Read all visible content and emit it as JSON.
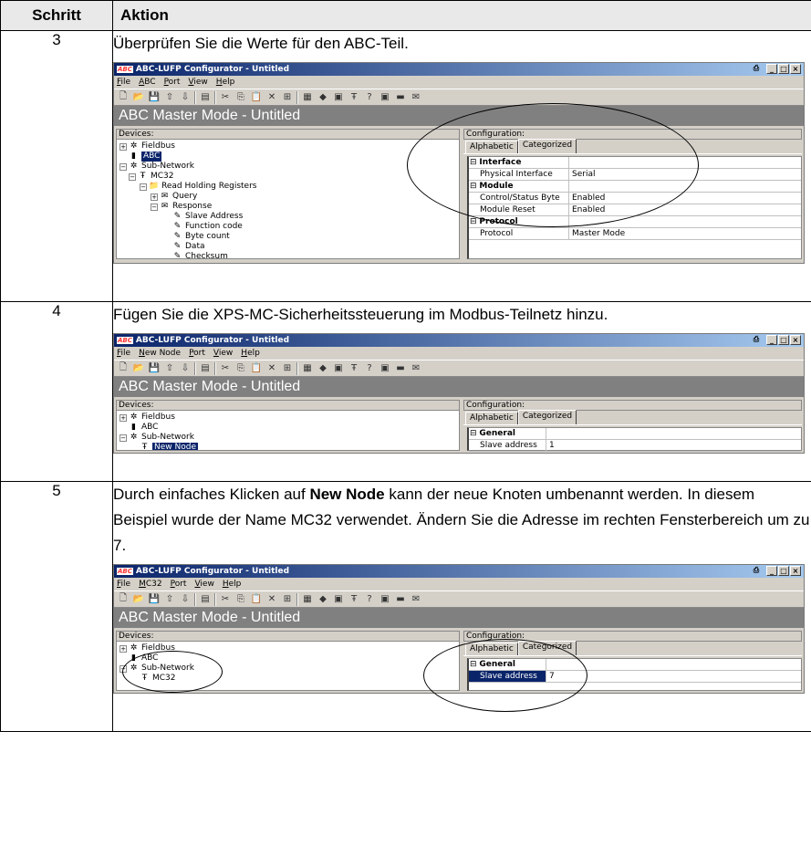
{
  "header": {
    "col_step": "Schritt",
    "col_action": "Aktion"
  },
  "rows": [
    {
      "step": "3",
      "text": "Überprüfen Sie die Werte für den ABC-Teil.",
      "window": {
        "title": "ABC-LUFP Configurator - Untitled",
        "app_logo": "ABC",
        "menu": [
          "File",
          "ABC",
          "Port",
          "View",
          "Help"
        ],
        "mode_title": "ABC Master Mode - Untitled",
        "devices_label": "Devices:",
        "config_label": "Configuration:",
        "tab_alphabetic": "Alphabetic",
        "tab_categorized": "Categorized",
        "tree": [
          "Fieldbus",
          "ABC",
          "Sub-Network",
          "MC32",
          "Read Holding Registers",
          "Query",
          "Response",
          "Slave Address",
          "Function code",
          "Byte count",
          "Data",
          "Checksum"
        ],
        "grid": [
          {
            "k": "Interface",
            "v": "",
            "cat": true
          },
          {
            "k": "Physical Interface",
            "v": "Serial"
          },
          {
            "k": "Module",
            "v": "",
            "cat": true
          },
          {
            "k": "Control/Status Byte",
            "v": "Enabled"
          },
          {
            "k": "Module Reset",
            "v": "Enabled"
          },
          {
            "k": "Protocol",
            "v": "",
            "cat": true
          },
          {
            "k": "Protocol",
            "v": "Master Mode"
          }
        ]
      }
    },
    {
      "step": "4",
      "text": "Fügen Sie die XPS-MC-Sicherheitssteuerung im Modbus-Teilnetz hinzu.",
      "window": {
        "title": "ABC-LUFP Configurator - Untitled",
        "app_logo": "ABC",
        "menu": [
          "File",
          "New Node",
          "Port",
          "View",
          "Help"
        ],
        "mode_title": "ABC Master Mode - Untitled",
        "devices_label": "Devices:",
        "config_label": "Configuration:",
        "tab_alphabetic": "Alphabetic",
        "tab_categorized": "Categorized",
        "tree": [
          "Fieldbus",
          "ABC",
          "Sub-Network",
          "New Node"
        ],
        "grid": [
          {
            "k": "General",
            "v": "",
            "cat": true
          },
          {
            "k": "Slave address",
            "v": "1"
          }
        ]
      }
    },
    {
      "step": "5",
      "text_pre": "Durch einfaches Klicken auf ",
      "text_bold": "New Node",
      "text_post": " kann der neue Knoten umbenannt werden. In diesem Beispiel wurde der Name MC32 verwendet. Ändern Sie die Adresse im rechten Fensterbereich um zu 7.",
      "window": {
        "title": "ABC-LUFP Configurator - Untitled",
        "app_logo": "ABC",
        "menu": [
          "File",
          "MC32",
          "Port",
          "View",
          "Help"
        ],
        "mode_title": "ABC Master Mode - Untitled",
        "devices_label": "Devices:",
        "config_label": "Configuration:",
        "tab_alphabetic": "Alphabetic",
        "tab_categorized": "Categorized",
        "tree": [
          "Fieldbus",
          "ABC",
          "Sub-Network",
          "MC32"
        ],
        "grid": [
          {
            "k": "General",
            "v": "",
            "cat": true
          },
          {
            "k": "Slave address",
            "v": "7"
          }
        ]
      }
    }
  ]
}
